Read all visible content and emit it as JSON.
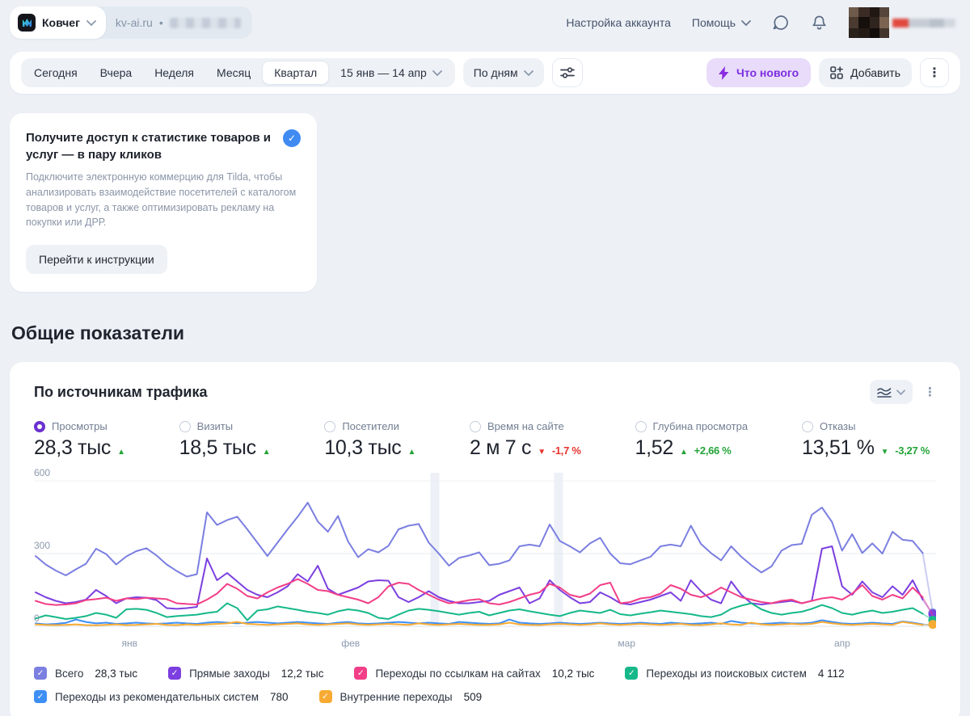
{
  "header": {
    "counter_name": "Ковчег",
    "site": "kv-ai.ru",
    "site_separator": "•",
    "account_settings": "Настройка аккаунта",
    "help": "Помощь"
  },
  "toolbar": {
    "periods": {
      "today": "Сегодня",
      "yesterday": "Вчера",
      "week": "Неделя",
      "month": "Месяц",
      "quarter": "Квартал"
    },
    "active_period": "Квартал",
    "date_range": "15 янв — 14 апр",
    "granularity": "По дням",
    "whats_new": "Что нового",
    "add": "Добавить"
  },
  "promo": {
    "title": "Получите доступ к статистике товаров и услуг — в пару кликов",
    "description": "Подключите электронную коммерцию для Tilda, чтобы анализировать взаимодействие посетителей с каталогом товаров и услуг, а также оптимизировать рекламу на покупки или ДРР.",
    "button": "Перейти к инструкции"
  },
  "section_title": "Общие показатели",
  "traffic_card": {
    "title": "По источникам трафика",
    "metrics": [
      {
        "label": "Просмотры",
        "value": "28,3 тыс",
        "trend": "up",
        "trend_color": "green",
        "pct": "",
        "selected": true
      },
      {
        "label": "Визиты",
        "value": "18,5 тыс",
        "trend": "up",
        "trend_color": "green",
        "pct": "",
        "selected": false
      },
      {
        "label": "Посетители",
        "value": "10,3 тыс",
        "trend": "up",
        "trend_color": "green",
        "pct": "",
        "selected": false
      },
      {
        "label": "Время на сайте",
        "value": "2 м 7 с",
        "trend": "down",
        "trend_color": "red",
        "pct": "-1,7 %",
        "selected": false
      },
      {
        "label": "Глубина просмотра",
        "value": "1,52",
        "trend": "up",
        "trend_color": "green",
        "pct": "+2,66 %",
        "selected": false
      },
      {
        "label": "Отказы",
        "value": "13,51 %",
        "trend": "down",
        "trend_color": "green",
        "pct": "-3,27 %",
        "selected": false
      }
    ]
  },
  "chart_data": {
    "type": "line",
    "title": "По источникам трафика",
    "x_range": [
      "15 янв",
      "14 апр"
    ],
    "x_tick_labels": [
      "янв",
      "фев",
      "мар",
      "апр"
    ],
    "x_tick_fractions": [
      0.106,
      0.351,
      0.657,
      0.896
    ],
    "ylim": [
      0,
      600
    ],
    "y_ticks": [
      0,
      300,
      600
    ],
    "grid": true,
    "legend_position": "bottom",
    "highlight_band_fractions": [
      0.444,
      0.581
    ],
    "series": [
      {
        "name": "Всего",
        "total_label": "28,3 тыс",
        "color": "#7b7fe0",
        "end_dot": true,
        "values": [
          290,
          255,
          230,
          210,
          235,
          258,
          320,
          298,
          255,
          288,
          310,
          322,
          292,
          255,
          228,
          205,
          215,
          470,
          418,
          438,
          452,
          400,
          345,
          290,
          345,
          400,
          452,
          510,
          432,
          390,
          455,
          350,
          285,
          318,
          305,
          332,
          400,
          415,
          422,
          345,
          300,
          250,
          282,
          292,
          305,
          252,
          258,
          272,
          330,
          337,
          330,
          420,
          352,
          330,
          305,
          342,
          365,
          300,
          260,
          256,
          272,
          287,
          330,
          337,
          330,
          415,
          340,
          302,
          272,
          330,
          287,
          252,
          222,
          247,
          312,
          335,
          340,
          460,
          490,
          430,
          312,
          380,
          302,
          342,
          300,
          390,
          357,
          352,
          302,
          55
        ]
      },
      {
        "name": "Прямые заходы",
        "total_label": "12,2 тыс",
        "color": "#7c3fe0",
        "end_dot": true,
        "values": [
          140,
          120,
          105,
          95,
          100,
          110,
          150,
          125,
          95,
          115,
          120,
          118,
          108,
          75,
          72,
          75,
          80,
          280,
          190,
          220,
          185,
          150,
          130,
          120,
          140,
          165,
          215,
          185,
          250,
          155,
          130,
          145,
          160,
          185,
          190,
          188,
          120,
          100,
          120,
          145,
          120,
          105,
          95,
          95,
          100,
          105,
          130,
          145,
          160,
          95,
          115,
          190,
          150,
          120,
          95,
          100,
          140,
          120,
          95,
          90,
          100,
          110,
          125,
          140,
          105,
          190,
          145,
          110,
          95,
          185,
          130,
          95,
          90,
          95,
          100,
          105,
          95,
          105,
          320,
          330,
          165,
          130,
          185,
          140,
          120,
          165,
          130,
          190,
          110,
          50
        ]
      },
      {
        "name": "Переходы по ссылкам на сайтах",
        "total_label": "10,2 тыс",
        "color": "#f23f87",
        "end_dot": false,
        "values": [
          105,
          92,
          88,
          90,
          95,
          108,
          112,
          118,
          105,
          115,
          112,
          118,
          115,
          112,
          95,
          92,
          90,
          110,
          135,
          175,
          155,
          125,
          115,
          140,
          160,
          175,
          195,
          175,
          150,
          145,
          130,
          120,
          110,
          95,
          120,
          165,
          180,
          175,
          150,
          130,
          110,
          95,
          100,
          108,
          112,
          95,
          90,
          100,
          115,
          130,
          140,
          175,
          160,
          130,
          120,
          135,
          170,
          180,
          95,
          100,
          115,
          120,
          135,
          170,
          155,
          130,
          120,
          135,
          160,
          140,
          120,
          110,
          100,
          95,
          105,
          110,
          95,
          105,
          115,
          120,
          110,
          135,
          170,
          125,
          110,
          130,
          115,
          160,
          120,
          45
        ]
      },
      {
        "name": "Переходы из поисковых систем",
        "total_label": "4 112",
        "color": "#16b88a",
        "end_dot": true,
        "values": [
          32,
          45,
          38,
          30,
          35,
          42,
          55,
          48,
          35,
          70,
          72,
          68,
          55,
          38,
          42,
          45,
          48,
          55,
          60,
          95,
          75,
          25,
          65,
          70,
          82,
          75,
          68,
          60,
          55,
          48,
          62,
          70,
          65,
          55,
          35,
          30,
          48,
          65,
          72,
          68,
          62,
          55,
          48,
          55,
          60,
          45,
          55,
          65,
          70,
          62,
          55,
          48,
          42,
          55,
          65,
          60,
          55,
          68,
          50,
          45,
          52,
          58,
          65,
          60,
          55,
          50,
          42,
          38,
          48,
          72,
          85,
          95,
          70,
          55,
          48,
          55,
          60,
          72,
          88,
          75,
          55,
          48,
          58,
          65,
          55,
          60,
          68,
          75,
          52,
          25
        ]
      },
      {
        "name": "Переходы из рекомендательных систем",
        "total_label": "780",
        "color": "#3e8ff5",
        "end_dot": false,
        "values": [
          12,
          8,
          10,
          14,
          28,
          18,
          12,
          15,
          10,
          12,
          15,
          12,
          10,
          12,
          15,
          12,
          10,
          15,
          18,
          15,
          12,
          15,
          18,
          15,
          12,
          15,
          18,
          15,
          12,
          10,
          15,
          18,
          12,
          10,
          12,
          15,
          18,
          15,
          12,
          15,
          12,
          10,
          18,
          15,
          12,
          10,
          12,
          28,
          15,
          12,
          10,
          12,
          15,
          12,
          10,
          12,
          15,
          12,
          10,
          12,
          15,
          12,
          10,
          15,
          12,
          10,
          12,
          15,
          10,
          22,
          15,
          12,
          10,
          12,
          15,
          12,
          12,
          15,
          25,
          18,
          12,
          10,
          12,
          15,
          12,
          10,
          20,
          15,
          8,
          5
        ]
      },
      {
        "name": "Внутренние переходы",
        "total_label": "509",
        "color": "#f7ab33",
        "end_dot": true,
        "values": [
          8,
          6,
          5,
          6,
          8,
          5,
          4,
          6,
          8,
          5,
          6,
          8,
          10,
          6,
          5,
          8,
          6,
          8,
          10,
          12,
          18,
          10,
          8,
          6,
          8,
          10,
          12,
          8,
          6,
          8,
          10,
          12,
          8,
          6,
          8,
          10,
          8,
          6,
          12,
          8,
          6,
          8,
          10,
          8,
          6,
          6,
          8,
          15,
          8,
          6,
          5,
          8,
          10,
          8,
          6,
          8,
          12,
          8,
          6,
          8,
          10,
          8,
          6,
          8,
          10,
          6,
          5,
          8,
          12,
          8,
          6,
          15,
          8,
          6,
          8,
          10,
          8,
          10,
          18,
          12,
          8,
          6,
          8,
          10,
          8,
          6,
          18,
          12,
          6,
          8
        ]
      }
    ]
  }
}
